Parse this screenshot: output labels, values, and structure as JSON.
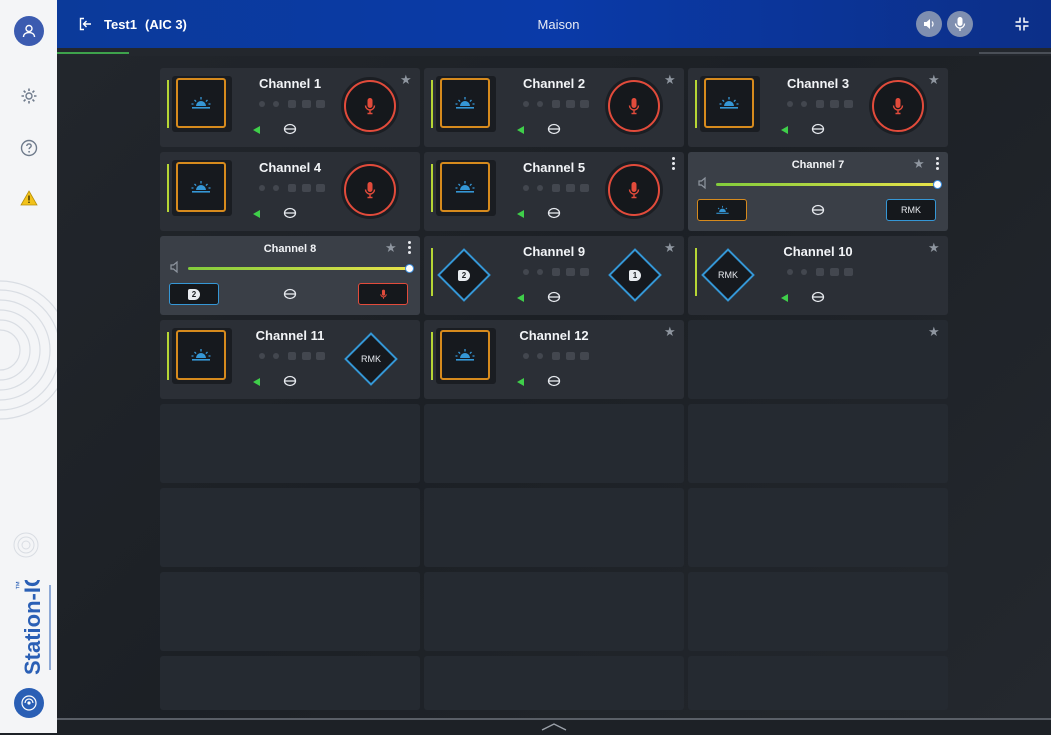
{
  "app": {
    "title": "Test1",
    "subtitle": "(AIC 3)",
    "location": "Maison",
    "brand": "Station-IC",
    "brand_tm": "™"
  },
  "sidebar": {
    "icons": [
      "user-icon",
      "gear-icon",
      "help-icon",
      "warning-icon"
    ]
  },
  "colors": {
    "accent_orange": "#d68a1d",
    "mic_red": "#e24b3b",
    "diamond_blue": "#3597d6",
    "talk_green": "#3fcf4a",
    "topbar_blue": "#0b3a9a"
  },
  "channels": [
    {
      "name": "Channel 1",
      "mode": "full",
      "right": "mic",
      "starred": false,
      "menu": false
    },
    {
      "name": "Channel 2",
      "mode": "full",
      "right": "mic",
      "starred": false,
      "menu": false
    },
    {
      "name": "Channel 3",
      "mode": "full",
      "right": "mic",
      "starred": false,
      "menu": false
    },
    {
      "name": "Channel 4",
      "mode": "full",
      "right": "mic",
      "starred": false,
      "menu": false
    },
    {
      "name": "Channel 5",
      "mode": "full",
      "right": "mic",
      "starred": false,
      "menu": true
    },
    {
      "name": "Channel 7",
      "mode": "volume",
      "right_label": "RMK",
      "starred": false,
      "menu": true,
      "volume": 1.0
    },
    {
      "name": "Channel 8",
      "mode": "volume",
      "left_badge": "2",
      "starred": false,
      "menu": true,
      "volume": 1.0
    },
    {
      "name": "Channel 9",
      "mode": "diamond",
      "left_badge": "2",
      "right_badge": "1",
      "starred": false,
      "menu": false
    },
    {
      "name": "Channel 10",
      "mode": "diamond-left",
      "left_label": "RMK",
      "starred": false,
      "menu": false
    },
    {
      "name": "Channel 11",
      "mode": "full",
      "right_label": "RMK",
      "starred": false,
      "menu": false
    },
    {
      "name": "Channel 12",
      "mode": "full",
      "starred": false,
      "menu": false
    }
  ]
}
